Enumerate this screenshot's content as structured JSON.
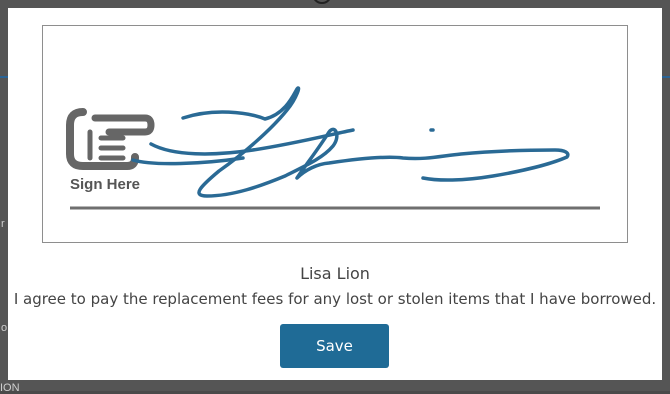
{
  "background": {
    "fragments": [
      "r",
      "o",
      "ION"
    ]
  },
  "signature_pad": {
    "prompt_label": "Sign Here"
  },
  "signer": {
    "name": "Lisa Lion"
  },
  "agreement": {
    "text": "I agree to pay the replacement fees for any lost or stolen items that I have borrowed."
  },
  "actions": {
    "save_label": "Save"
  },
  "colors": {
    "signature_ink": "#2a6a95",
    "button": "#1f6b96",
    "overlay": "#555555",
    "sign_here_icon": "#666666"
  }
}
